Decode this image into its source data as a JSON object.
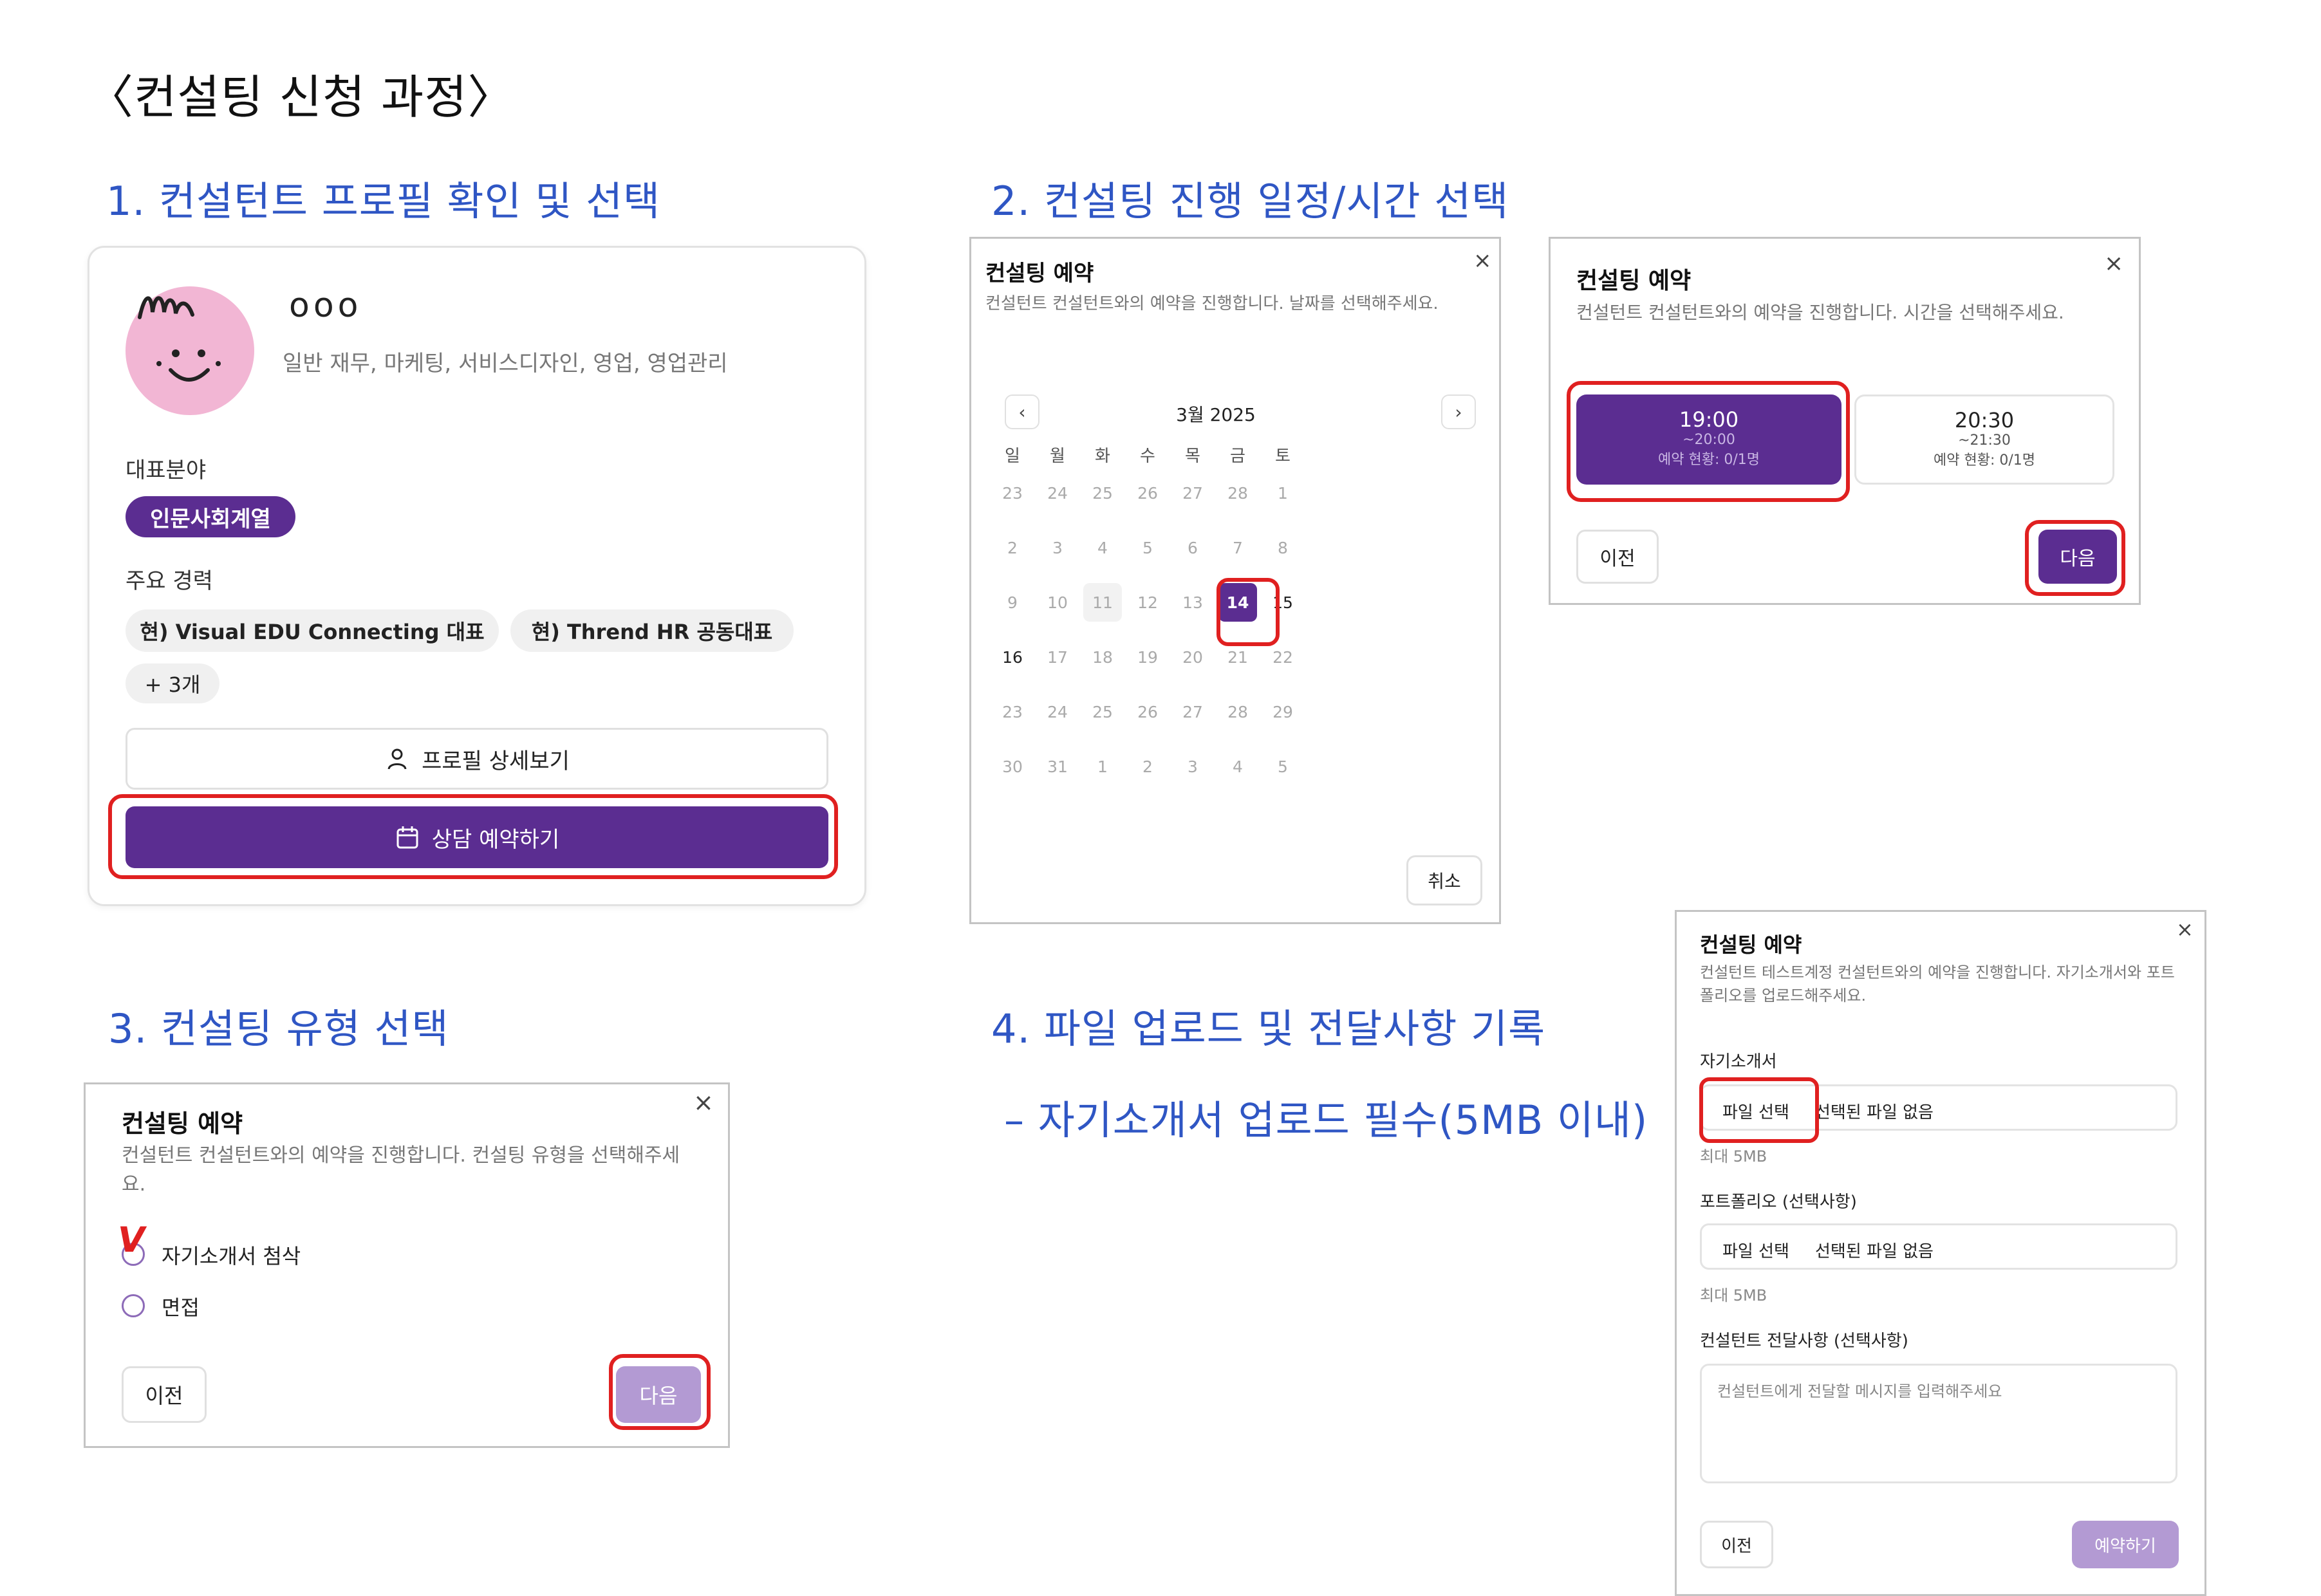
{
  "page_title": "〈컨설팅 신청 과정〉",
  "steps": {
    "s1": "1. 컨설턴트 프로필 확인 및 선택",
    "s2": "2. 컨설팅 진행 일정/시간 선택",
    "s3": "3. 컨설팅 유형 선택",
    "s4": "4. 파일 업로드 및 전달사항 기록",
    "s4_note": "– 자기소개서 업로드 필수(5MB 이내)"
  },
  "profile": {
    "name": "ooo",
    "fields": "일반 재무, 마케팅, 서비스디자인, 영업, 영업관리",
    "rep_label": "대표분야",
    "rep_tag": "인문사회계열",
    "career_label": "주요 경력",
    "career1": "현) Visual EDU Connecting 대표",
    "career2": "현) Thrend HR 공동대표",
    "career_more": "+ 3개",
    "detail_button": "프로필 상세보기",
    "reserve_button": "상담 예약하기"
  },
  "date_dialog": {
    "title": "컨설팅 예약",
    "desc": "컨설턴트 컨설턴트와의 예약을 진행합니다. 날짜를 선택해주세요.",
    "month": "3월 2025",
    "weekdays": [
      "일",
      "월",
      "화",
      "수",
      "목",
      "금",
      "토"
    ],
    "weeks": [
      [
        "23",
        "24",
        "25",
        "26",
        "27",
        "28",
        "1"
      ],
      [
        "2",
        "3",
        "4",
        "5",
        "6",
        "7",
        "8"
      ],
      [
        "9",
        "10",
        "11",
        "12",
        "13",
        "14",
        "15"
      ],
      [
        "16",
        "17",
        "18",
        "19",
        "20",
        "21",
        "22"
      ],
      [
        "23",
        "24",
        "25",
        "26",
        "27",
        "28",
        "29"
      ],
      [
        "30",
        "31",
        "1",
        "2",
        "3",
        "4",
        "5"
      ]
    ],
    "selected": "14",
    "cancel": "취소"
  },
  "time_dialog": {
    "title": "컨설팅 예약",
    "desc": "컨설턴트 컨설턴트와의 예약을 진행합니다. 시간을 선택해주세요.",
    "slot1_time": "19:00",
    "slot1_end": "~20:00",
    "slot1_status": "예약 현황: 0/1명",
    "slot2_time": "20:30",
    "slot2_end": "~21:30",
    "slot2_status": "예약 현황: 0/1명",
    "prev": "이전",
    "next": "다음"
  },
  "type_dialog": {
    "title": "컨설팅 예약",
    "desc": "컨설턴트 컨설턴트와의 예약을 진행합니다. 컨설팅 유형을 선택해주세요.",
    "option1": "자기소개서 첨삭",
    "option2": "면접",
    "checkmark": "V",
    "prev": "이전",
    "next": "다음"
  },
  "upload_dialog": {
    "title": "컨설팅 예약",
    "desc": "컨설턴트 테스트계정 컨설턴트와의 예약을 진행합니다. 자기소개서와 포트폴리오를 업로드해주세요.",
    "cover_label": "자기소개서",
    "file_btn": "파일 선택",
    "no_file": "선택된 파일 없음",
    "max1": "최대 5MB",
    "portfolio_label": "포트폴리오 (선택사항)",
    "file_btn2": "파일 선택",
    "no_file2": "선택된 파일 없음",
    "max2": "최대 5MB",
    "msg_label": "컨설턴트 전달사항 (선택사항)",
    "msg_placeholder": "컨설턴트에게 전달할 메시지를 입력해주세요",
    "prev": "이전",
    "submit": "예약하기"
  },
  "colors": {
    "primary": "#5b2d91",
    "primary_light": "#b39ad3",
    "highlight_red": "#e02020",
    "step_blue": "#2f56c4",
    "avatar_pink": "#f2b6d4"
  }
}
